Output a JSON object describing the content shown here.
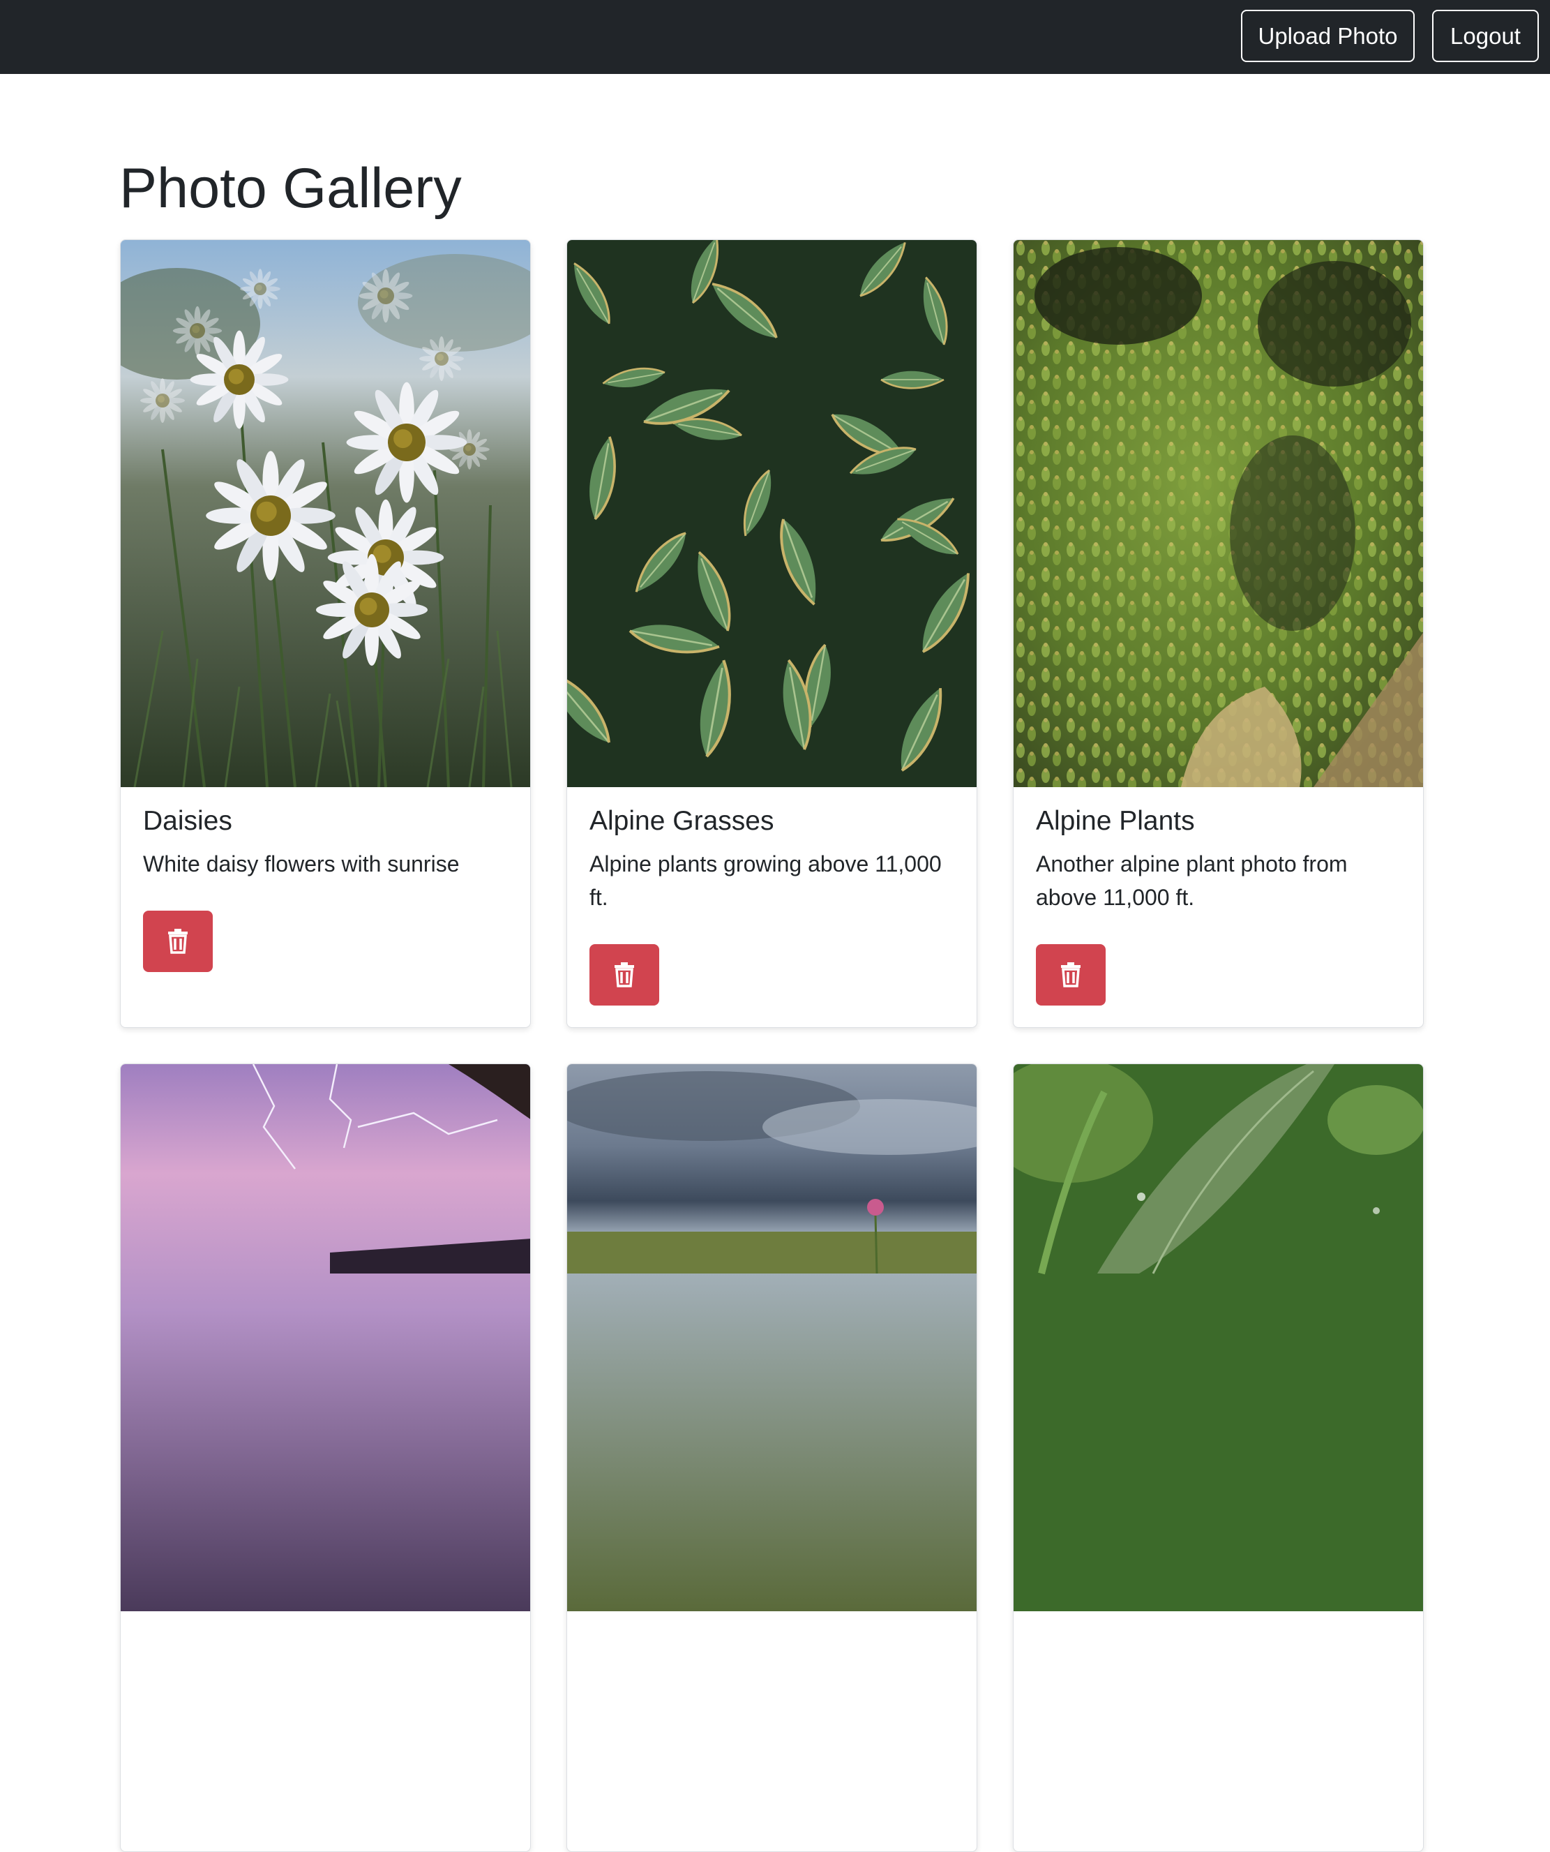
{
  "navbar": {
    "upload_label": "Upload Photo",
    "logout_label": "Logout"
  },
  "page": {
    "title": "Photo Gallery"
  },
  "photos": [
    {
      "title": "Daisies",
      "description": "White daisy flowers with sunrise"
    },
    {
      "title": "Alpine Grasses",
      "description": "Alpine plants growing above 11,000 ft."
    },
    {
      "title": "Alpine Plants",
      "description": "Another alpine plant photo from above 11,000 ft."
    },
    {
      "title": "",
      "description": ""
    },
    {
      "title": "",
      "description": ""
    },
    {
      "title": "",
      "description": ""
    }
  ],
  "colors": {
    "navbar_bg": "#212529",
    "danger": "#d1444f",
    "text": "#212529"
  },
  "icons": {
    "delete": "trash-icon"
  }
}
